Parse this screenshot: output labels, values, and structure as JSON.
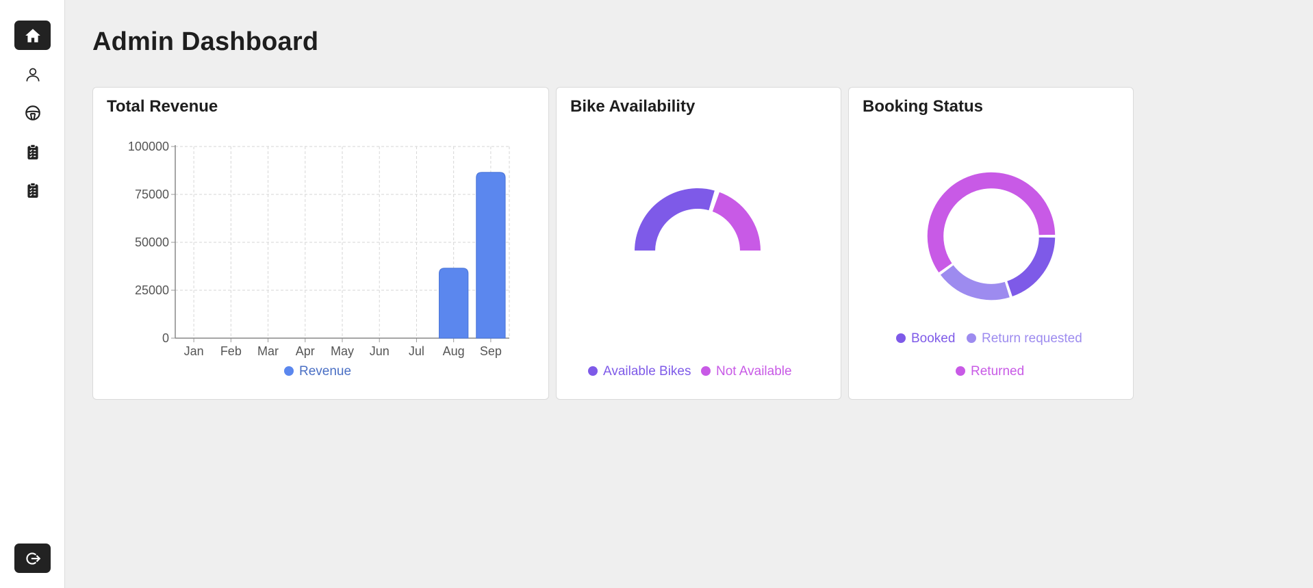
{
  "page": {
    "title": "Admin Dashboard"
  },
  "sidebar": {
    "items": [
      {
        "icon": "home-icon",
        "active": true
      },
      {
        "icon": "user-icon",
        "active": false
      },
      {
        "icon": "steering-wheel-icon",
        "active": false
      },
      {
        "icon": "clipboard-list-icon",
        "active": false
      },
      {
        "icon": "clipboard-list-icon",
        "active": false
      }
    ],
    "logout_icon": "logout-icon"
  },
  "colors": {
    "bar": "#5b87ee",
    "purple": "#7e5ae8",
    "magenta": "#c85ae6",
    "lavender": "#9d8bef",
    "revenue_legend_text": "#4a6fc4"
  },
  "cards": {
    "revenue": {
      "title": "Total Revenue"
    },
    "bikes": {
      "title": "Bike Availability"
    },
    "booking": {
      "title": "Booking Status"
    }
  },
  "chart_data": [
    {
      "type": "bar",
      "title": "Total Revenue",
      "categories": [
        "Jan",
        "Feb",
        "Mar",
        "Apr",
        "May",
        "Jun",
        "Jul",
        "Aug",
        "Sep"
      ],
      "series": [
        {
          "name": "Revenue",
          "values": [
            0,
            0,
            0,
            0,
            0,
            0,
            0,
            36500,
            86500
          ]
        }
      ],
      "ylim": [
        0,
        100000
      ],
      "yticks": [
        "0",
        "25000",
        "50000",
        "75000",
        "100000"
      ],
      "grid": true,
      "legend": "bottom"
    },
    {
      "type": "pie",
      "title": "Bike Availability",
      "style": "half-doughnut",
      "labels": [
        "Available Bikes",
        "Not Available"
      ],
      "values": [
        6,
        4
      ],
      "legend": "bottom"
    },
    {
      "type": "pie",
      "title": "Booking Status",
      "style": "doughnut",
      "labels": [
        "Booked",
        "Return requested",
        "Returned"
      ],
      "values": [
        2,
        2,
        6
      ],
      "legend": "bottom"
    }
  ]
}
